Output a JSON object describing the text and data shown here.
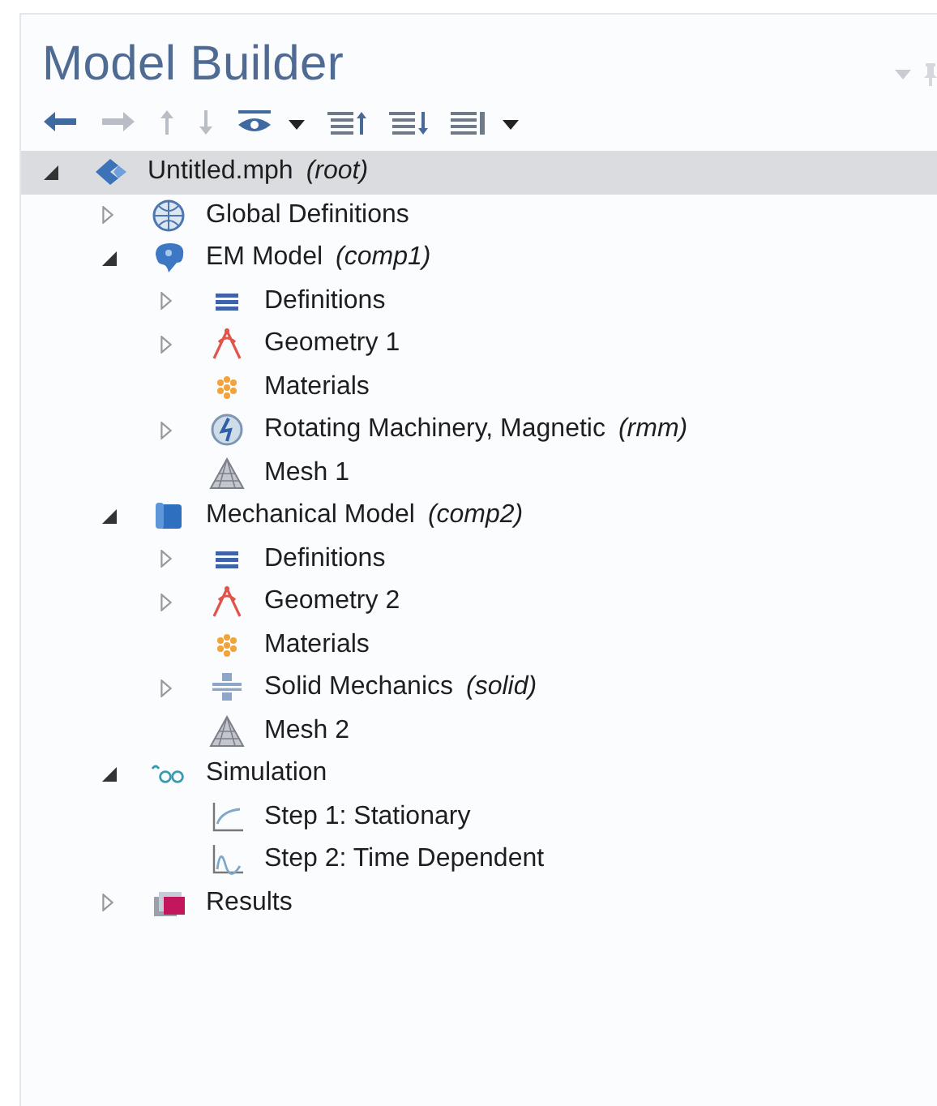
{
  "panel": {
    "title": "Model Builder"
  },
  "toolbar": [
    {
      "kind": "back",
      "disabled": false
    },
    {
      "kind": "forward",
      "disabled": true
    },
    {
      "kind": "up",
      "disabled": true
    },
    {
      "kind": "down",
      "disabled": true
    },
    {
      "kind": "show",
      "disabled": false
    },
    {
      "kind": "dropdown",
      "disabled": false
    },
    {
      "kind": "collapse-all",
      "disabled": false
    },
    {
      "kind": "expand-all",
      "disabled": false
    },
    {
      "kind": "view",
      "disabled": false
    },
    {
      "kind": "dropdown",
      "disabled": false
    }
  ],
  "tree": [
    {
      "label": "Untitled.mph",
      "tag": "(root)",
      "kind": "root",
      "selected": true,
      "expanded": true,
      "children": [
        {
          "label": "Global Definitions",
          "kind": "globe",
          "selected": false,
          "expanded": false
        },
        {
          "label": "EM Model",
          "tag": "(comp1)",
          "kind": "component-em",
          "selected": false,
          "expanded": true,
          "children": [
            {
              "label": "Definitions",
              "kind": "definitions",
              "selected": false,
              "expanded": false
            },
            {
              "label": "Geometry 1",
              "kind": "geometry",
              "selected": false,
              "expanded": false
            },
            {
              "label": "Materials",
              "kind": "materials",
              "selected": false
            },
            {
              "label": "Rotating Machinery, Magnetic",
              "tag": "(rmm)",
              "kind": "rotating",
              "selected": false,
              "expanded": false
            },
            {
              "label": "Mesh 1",
              "kind": "mesh",
              "selected": false
            }
          ]
        },
        {
          "label": "Mechanical Model",
          "tag": "(comp2)",
          "kind": "component-mech",
          "selected": false,
          "expanded": true,
          "children": [
            {
              "label": "Definitions",
              "kind": "definitions",
              "selected": false,
              "expanded": false
            },
            {
              "label": "Geometry 2",
              "kind": "geometry",
              "selected": false,
              "expanded": false
            },
            {
              "label": "Materials",
              "kind": "materials",
              "selected": false
            },
            {
              "label": "Solid Mechanics",
              "tag": "(solid)",
              "kind": "solid",
              "selected": false,
              "expanded": false
            },
            {
              "label": "Mesh 2",
              "kind": "mesh",
              "selected": false
            }
          ]
        },
        {
          "label": "Simulation",
          "kind": "study",
          "selected": false,
          "expanded": true,
          "children": [
            {
              "label": "Step 1: Stationary",
              "kind": "step-stationary",
              "selected": false
            },
            {
              "label": "Step 2: Time Dependent",
              "kind": "step-time",
              "selected": false
            }
          ]
        },
        {
          "label": "Results",
          "kind": "results",
          "selected": false,
          "expanded": false
        }
      ]
    }
  ]
}
